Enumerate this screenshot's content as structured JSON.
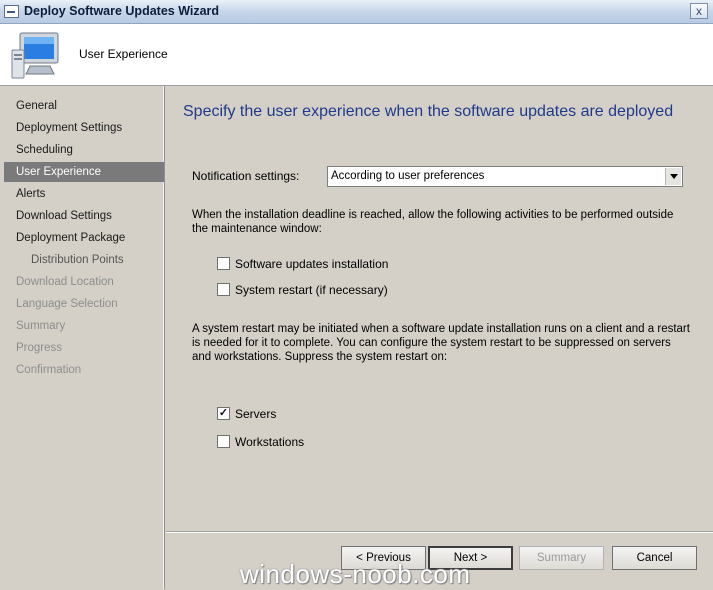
{
  "window": {
    "title": "Deploy Software Updates Wizard",
    "close_glyph": "x"
  },
  "header": {
    "title": "User Experience",
    "icon": "computer-monitor-icon"
  },
  "sidebar": {
    "items": [
      {
        "label": "General",
        "state": "normal"
      },
      {
        "label": "Deployment Settings",
        "state": "normal"
      },
      {
        "label": "Scheduling",
        "state": "normal"
      },
      {
        "label": "User Experience",
        "state": "active"
      },
      {
        "label": "Alerts",
        "state": "normal"
      },
      {
        "label": "Download Settings",
        "state": "normal"
      },
      {
        "label": "Deployment Package",
        "state": "normal"
      },
      {
        "label": "Distribution Points",
        "state": "normal-sub"
      },
      {
        "label": "Download Location",
        "state": "disabled"
      },
      {
        "label": "Language Selection",
        "state": "disabled"
      },
      {
        "label": "Summary",
        "state": "disabled"
      },
      {
        "label": "Progress",
        "state": "disabled"
      },
      {
        "label": "Confirmation",
        "state": "disabled"
      }
    ]
  },
  "main": {
    "heading": "Specify the user experience when the software updates are deployed",
    "notification": {
      "label": "Notification settings:",
      "value": "According to user preferences"
    },
    "deadline_text": "When the installation deadline is reached, allow the following activities to be performed outside the maintenance window:",
    "deadline_options": [
      {
        "label": "Software updates installation",
        "checked": false
      },
      {
        "label": "System restart (if necessary)",
        "checked": false
      }
    ],
    "restart_text": "A system restart may be initiated when a software update installation runs on a client and a restart is needed for it to complete. You can configure the system restart to be suppressed on servers and workstations. Suppress the system restart on:",
    "suppress_options": [
      {
        "label": "Servers",
        "checked": true
      },
      {
        "label": "Workstations",
        "checked": false
      }
    ]
  },
  "buttons": {
    "previous": "< Previous",
    "next": "Next >",
    "summary": "Summary",
    "cancel": "Cancel"
  },
  "watermark": "windows-noob.com",
  "colors": {
    "heading": "#1f3a8a",
    "active_nav": "#7a7a7a",
    "face": "#d4d0c8"
  }
}
